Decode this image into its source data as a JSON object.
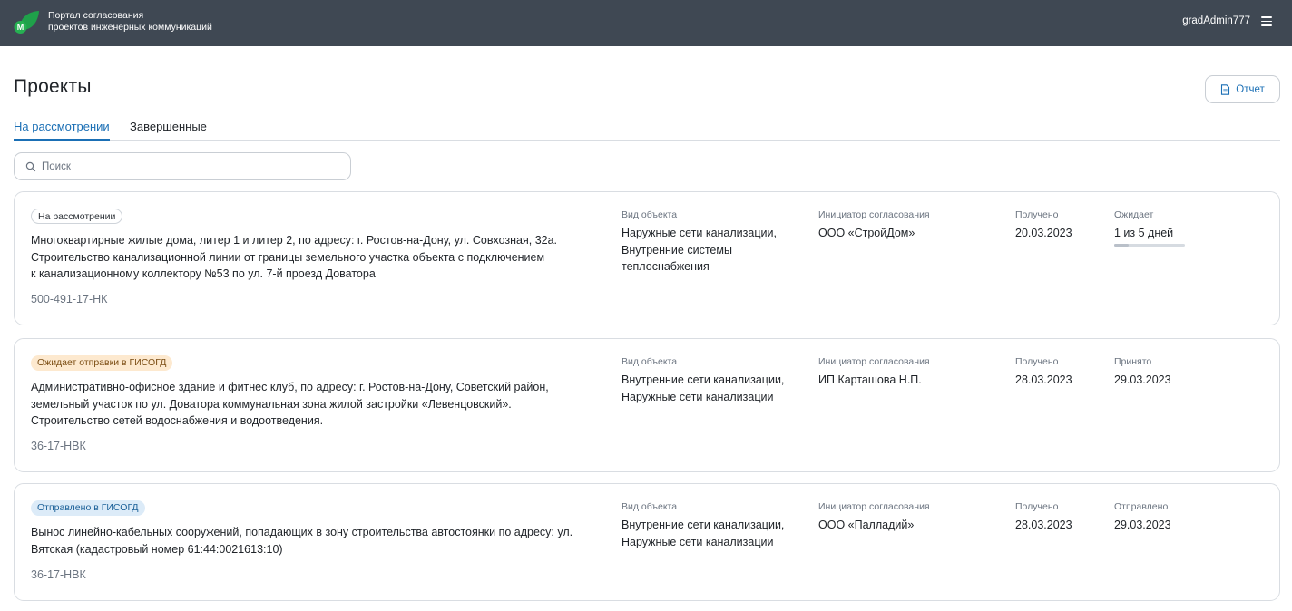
{
  "header": {
    "brand_line1": "Портал согласования",
    "brand_line2": "проектов инженерных коммуникаций",
    "logo_letter": "М",
    "username": "gradAdmin777"
  },
  "page": {
    "title": "Проекты",
    "report_label": "Отчет"
  },
  "tabs": [
    {
      "label": "На рассмотрении",
      "active": true
    },
    {
      "label": "Завершенные",
      "active": false
    }
  ],
  "search": {
    "placeholder": "Поиск",
    "value": ""
  },
  "columns": {
    "object_type": "Вид объекта",
    "initiator": "Инициатор согласования",
    "received": "Получено"
  },
  "projects": [
    {
      "status": "На рассмотрении",
      "desc_lines": [
        "Многоквартирные жилые дома, литер 1 и литер 2, по адресу: г. Ростов-на-Дону, ул. Совхозная, 32а.",
        "Строительство канализационной линии от границы земельного участка объекта с подключением",
        "к канализационному коллектору №53 по ул. 7-й проезд Доватора"
      ],
      "code": "500-491-17-НК",
      "object_type_lines": [
        "Наружные сети канализации,",
        "Внутренние системы",
        "теплоснабжения"
      ],
      "initiator": "ООО «СтройДом»",
      "received": "20.03.2023",
      "extra_label": "Ожидает",
      "extra_value": "1 из 5 дней",
      "wait_progress": 0.2
    },
    {
      "status": "Ожидает отправки в ГИСОГД",
      "desc_lines": [
        "Административно-офисное здание и фитнес клуб, по адресу: г. Ростов-на-Дону, Советский район,",
        "земельный участок по ул. Доватора коммунальная зона жилой застройки «Левенцовский».",
        "Строительство сетей водоснабжения и водоотведения."
      ],
      "code": "36-17-НВК",
      "object_type_lines": [
        "Внутренние сети канализации,",
        "Наружные сети канализации"
      ],
      "initiator": "ИП Карташова Н.П.",
      "received": "28.03.2023",
      "extra_label": "Принято",
      "extra_value": "29.03.2023"
    },
    {
      "status": "Отправлено в ГИСОГД",
      "desc_lines": [
        "Вынос линейно-кабельных сооружений, попадающих в зону строительства автостоянки по адресу: ул.",
        "Вятская (кадастровый номер 61:44:0021613:10)"
      ],
      "code": "36-17-НВК",
      "object_type_lines": [
        "Внутренние сети канализации,",
        "Наружные сети канализации"
      ],
      "initiator": "ООО «Палладий»",
      "received": "28.03.2023",
      "extra_label": "Отправлено",
      "extra_value": "29.03.2023"
    }
  ],
  "colors": {
    "header_bg": "#3f4853",
    "accent": "#1a6fb5",
    "badge_waiting_bg": "#fde9cf",
    "badge_sent_bg": "#dcebf8",
    "logo_green": "#1fa14a"
  }
}
